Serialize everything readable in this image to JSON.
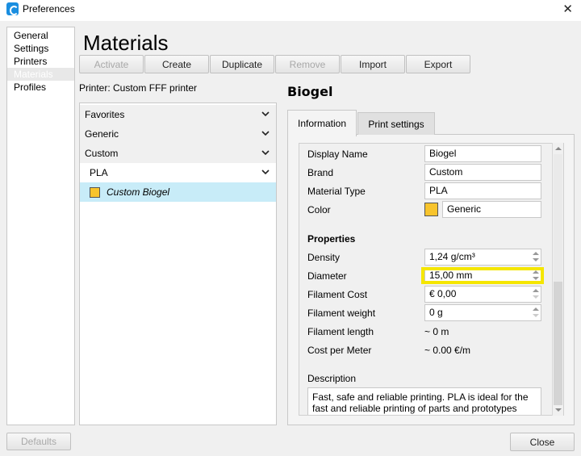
{
  "window": {
    "title": "Preferences",
    "close_icon": "close-icon"
  },
  "nav": {
    "items": [
      {
        "label": "General",
        "selected": false
      },
      {
        "label": "Settings",
        "selected": false
      },
      {
        "label": "Printers",
        "selected": false
      },
      {
        "label": "Materials",
        "selected": true
      },
      {
        "label": "Profiles",
        "selected": false
      }
    ]
  },
  "page": {
    "title": "Materials"
  },
  "toolbar": {
    "activate": "Activate",
    "create": "Create",
    "duplicate": "Duplicate",
    "remove": "Remove",
    "import": "Import",
    "export": "Export"
  },
  "printer_label": "Printer: Custom FFF printer",
  "material_list": {
    "groups": [
      {
        "label": "Favorites"
      },
      {
        "label": "Generic"
      },
      {
        "label": "Custom"
      }
    ],
    "subgroup": {
      "label": "PLA"
    },
    "selected_item": {
      "label": "Custom Biogel",
      "color": "#f8c42c"
    }
  },
  "detail": {
    "title": "Biogel",
    "tabs": [
      {
        "label": "Information",
        "active": true
      },
      {
        "label": "Print settings",
        "active": false
      }
    ],
    "fields": {
      "display_name": {
        "label": "Display Name",
        "value": "Biogel"
      },
      "brand": {
        "label": "Brand",
        "value": "Custom"
      },
      "material_type": {
        "label": "Material Type",
        "value": "PLA"
      },
      "color": {
        "label": "Color",
        "value": "Generic",
        "swatch": "#f8c42c"
      }
    },
    "properties": {
      "heading": "Properties",
      "density": {
        "label": "Density",
        "value": "1,24 g/cm³"
      },
      "diameter": {
        "label": "Diameter",
        "value": "15,00 mm",
        "highlight_color": "#f5e600"
      },
      "filament_cost": {
        "label": "Filament Cost",
        "value": "€ 0,00"
      },
      "filament_weight": {
        "label": "Filament weight",
        "value": "0 g"
      },
      "filament_length": {
        "label": "Filament length",
        "value": "~ 0 m"
      },
      "cost_per_meter": {
        "label": "Cost per Meter",
        "value": "~ 0.00 €/m"
      }
    },
    "description": {
      "label": "Description",
      "value": "Fast, safe and reliable printing. PLA is ideal for the fast and reliable printing of parts and prototypes"
    }
  },
  "footer": {
    "defaults": "Defaults",
    "close": "Close"
  }
}
